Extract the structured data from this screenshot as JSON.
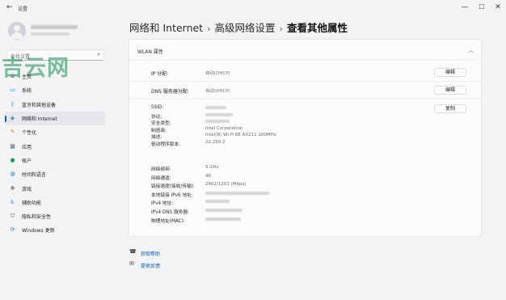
{
  "window": {
    "title": "设置",
    "back_icon": "back-arrow-icon",
    "minimize": "—",
    "maximize": "☐",
    "close": "✕"
  },
  "search": {
    "placeholder": "查找设置",
    "icon": "search-icon"
  },
  "watermark": "吉云网",
  "sidebar": {
    "items": [
      {
        "label": "主页",
        "icon": "home-icon",
        "glyph": "⌂",
        "color": "#444444",
        "active": false
      },
      {
        "label": "系统",
        "icon": "system-icon",
        "glyph": "▭",
        "color": "#0078d4",
        "active": false
      },
      {
        "label": "蓝牙和其他设备",
        "icon": "bluetooth-icon",
        "glyph": "ᛒ",
        "color": "#0067c0",
        "active": false
      },
      {
        "label": "网络和 Internet",
        "icon": "wifi-icon",
        "glyph": "◈",
        "color": "#2b6cb0",
        "active": true
      },
      {
        "label": "个性化",
        "icon": "brush-icon",
        "glyph": "✎",
        "color": "#d08a2a",
        "active": false
      },
      {
        "label": "应用",
        "icon": "apps-icon",
        "glyph": "▦",
        "color": "#5a6b86",
        "active": false
      },
      {
        "label": "帐户",
        "icon": "account-icon",
        "glyph": "●",
        "color": "#1e9e5a",
        "active": false
      },
      {
        "label": "时间和语言",
        "icon": "globe-icon",
        "glyph": "◍",
        "color": "#1a73c9",
        "active": false
      },
      {
        "label": "游戏",
        "icon": "gamepad-icon",
        "glyph": "✥",
        "color": "#666666",
        "active": false
      },
      {
        "label": "辅助功能",
        "icon": "accessibility-icon",
        "glyph": "♿",
        "color": "#2a7fd4",
        "active": false
      },
      {
        "label": "隐私和安全性",
        "icon": "shield-icon",
        "glyph": "⛉",
        "color": "#666666",
        "active": false
      },
      {
        "label": "Windows 更新",
        "icon": "update-icon",
        "glyph": "⟳",
        "color": "#0078d4",
        "active": false
      }
    ]
  },
  "breadcrumb": {
    "level1": "网络和 Internet",
    "level2": "高级网络设置",
    "current": "查看其他属性",
    "sep": "›"
  },
  "card": {
    "title": "WLAN 属性",
    "collapse_icon": "chevron-up-icon",
    "ip_assignment": {
      "label": "IP 分配:",
      "value": "自动(DHCP)",
      "button": "编辑"
    },
    "dns_assignment": {
      "label": "DNS 服务器分配:",
      "value": "自动(DHCP)",
      "button": "编辑"
    },
    "copy_button": "复制",
    "group1": [
      {
        "label": "SSID:",
        "value": ""
      },
      {
        "label": "协议:",
        "value": ""
      },
      {
        "label": "安全类型:",
        "value": ""
      },
      {
        "label": "制造商:",
        "value": "Intel Corporation"
      },
      {
        "label": "描述:",
        "value": "Intel(R) Wi-Fi 6E AX211 160MHz"
      },
      {
        "label": "驱动程序版本:",
        "value": "22.250.2"
      }
    ],
    "group2": [
      {
        "label": "网络频带:",
        "value": "5 GHz"
      },
      {
        "label": "网络通道:",
        "value": "48"
      },
      {
        "label": "链接速度(接收/传输):",
        "value": "2402/1201 (Mbps)"
      },
      {
        "label": "本地链接 IPv6 地址:",
        "value": ""
      },
      {
        "label": "IPv4 地址:",
        "value": ""
      },
      {
        "label": "IPv4 DNS 服务器:",
        "value": ""
      },
      {
        "label": "物理地址(MAC):",
        "value": ""
      }
    ]
  },
  "links": [
    {
      "label": "获取帮助",
      "icon": "help-icon",
      "glyph": "☎"
    },
    {
      "label": "提供反馈",
      "icon": "feedback-icon",
      "glyph": "✉"
    }
  ]
}
